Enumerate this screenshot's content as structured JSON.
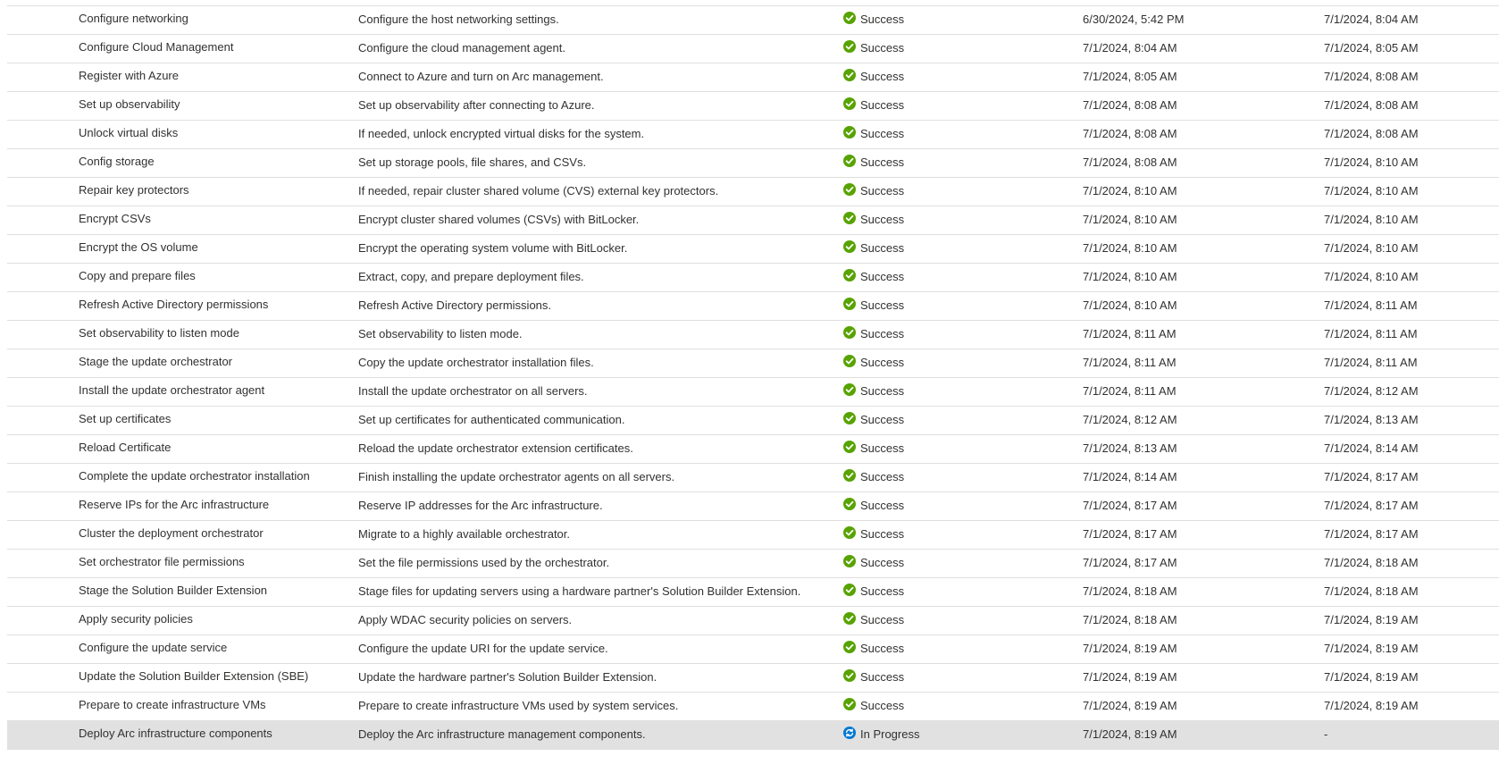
{
  "colors": {
    "success": "#57a300",
    "in_progress": "#0078d4",
    "row_border": "#e1dfdd",
    "selected_row": "#e1e1e1"
  },
  "rows": [
    {
      "name": "Configure networking",
      "description": "Configure the host networking settings.",
      "status": "Success",
      "status_icon": "success-check-icon",
      "start": "6/30/2024, 5:42 PM",
      "end": "7/1/2024, 8:04 AM"
    },
    {
      "name": "Configure Cloud Management",
      "description": "Configure the cloud management agent.",
      "status": "Success",
      "status_icon": "success-check-icon",
      "start": "7/1/2024, 8:04 AM",
      "end": "7/1/2024, 8:05 AM"
    },
    {
      "name": "Register with Azure",
      "description": "Connect to Azure and turn on Arc management.",
      "status": "Success",
      "status_icon": "success-check-icon",
      "start": "7/1/2024, 8:05 AM",
      "end": "7/1/2024, 8:08 AM"
    },
    {
      "name": "Set up observability",
      "description": "Set up observability after connecting to Azure.",
      "status": "Success",
      "status_icon": "success-check-icon",
      "start": "7/1/2024, 8:08 AM",
      "end": "7/1/2024, 8:08 AM"
    },
    {
      "name": "Unlock virtual disks",
      "description": "If needed, unlock encrypted virtual disks for the system.",
      "status": "Success",
      "status_icon": "success-check-icon",
      "start": "7/1/2024, 8:08 AM",
      "end": "7/1/2024, 8:08 AM"
    },
    {
      "name": "Config storage",
      "description": "Set up storage pools, file shares, and CSVs.",
      "status": "Success",
      "status_icon": "success-check-icon",
      "start": "7/1/2024, 8:08 AM",
      "end": "7/1/2024, 8:10 AM"
    },
    {
      "name": "Repair key protectors",
      "description": "If needed, repair cluster shared volume (CVS) external key protectors.",
      "status": "Success",
      "status_icon": "success-check-icon",
      "start": "7/1/2024, 8:10 AM",
      "end": "7/1/2024, 8:10 AM"
    },
    {
      "name": "Encrypt CSVs",
      "description": "Encrypt cluster shared volumes (CSVs) with BitLocker.",
      "status": "Success",
      "status_icon": "success-check-icon",
      "start": "7/1/2024, 8:10 AM",
      "end": "7/1/2024, 8:10 AM"
    },
    {
      "name": "Encrypt the OS volume",
      "description": "Encrypt the operating system volume with BitLocker.",
      "status": "Success",
      "status_icon": "success-check-icon",
      "start": "7/1/2024, 8:10 AM",
      "end": "7/1/2024, 8:10 AM"
    },
    {
      "name": "Copy and prepare files",
      "description": "Extract, copy, and prepare deployment files.",
      "status": "Success",
      "status_icon": "success-check-icon",
      "start": "7/1/2024, 8:10 AM",
      "end": "7/1/2024, 8:10 AM"
    },
    {
      "name": "Refresh Active Directory permissions",
      "description": "Refresh Active Directory permissions.",
      "status": "Success",
      "status_icon": "success-check-icon",
      "start": "7/1/2024, 8:10 AM",
      "end": "7/1/2024, 8:11 AM"
    },
    {
      "name": "Set observability to listen mode",
      "description": "Set observability to listen mode.",
      "status": "Success",
      "status_icon": "success-check-icon",
      "start": "7/1/2024, 8:11 AM",
      "end": "7/1/2024, 8:11 AM"
    },
    {
      "name": "Stage the update orchestrator",
      "description": "Copy the update orchestrator installation files.",
      "status": "Success",
      "status_icon": "success-check-icon",
      "start": "7/1/2024, 8:11 AM",
      "end": "7/1/2024, 8:11 AM"
    },
    {
      "name": "Install the update orchestrator agent",
      "description": "Install the update orchestrator on all servers.",
      "status": "Success",
      "status_icon": "success-check-icon",
      "start": "7/1/2024, 8:11 AM",
      "end": "7/1/2024, 8:12 AM"
    },
    {
      "name": "Set up certificates",
      "description": "Set up certificates for authenticated communication.",
      "status": "Success",
      "status_icon": "success-check-icon",
      "start": "7/1/2024, 8:12 AM",
      "end": "7/1/2024, 8:13 AM"
    },
    {
      "name": "Reload Certificate",
      "description": "Reload the update orchestrator extension certificates.",
      "status": "Success",
      "status_icon": "success-check-icon",
      "start": "7/1/2024, 8:13 AM",
      "end": "7/1/2024, 8:14 AM"
    },
    {
      "name": "Complete the update orchestrator installation",
      "description": "Finish installing the update orchestrator agents on all servers.",
      "status": "Success",
      "status_icon": "success-check-icon",
      "start": "7/1/2024, 8:14 AM",
      "end": "7/1/2024, 8:17 AM"
    },
    {
      "name": "Reserve IPs for the Arc infrastructure",
      "description": "Reserve IP addresses for the Arc infrastructure.",
      "status": "Success",
      "status_icon": "success-check-icon",
      "start": "7/1/2024, 8:17 AM",
      "end": "7/1/2024, 8:17 AM"
    },
    {
      "name": "Cluster the deployment orchestrator",
      "description": "Migrate to a highly available orchestrator.",
      "status": "Success",
      "status_icon": "success-check-icon",
      "start": "7/1/2024, 8:17 AM",
      "end": "7/1/2024, 8:17 AM"
    },
    {
      "name": "Set orchestrator file permissions",
      "description": "Set the file permissions used by the orchestrator.",
      "status": "Success",
      "status_icon": "success-check-icon",
      "start": "7/1/2024, 8:17 AM",
      "end": "7/1/2024, 8:18 AM"
    },
    {
      "name": "Stage the Solution Builder Extension",
      "description": "Stage files for updating servers using a hardware partner's Solution Builder Extension.",
      "status": "Success",
      "status_icon": "success-check-icon",
      "start": "7/1/2024, 8:18 AM",
      "end": "7/1/2024, 8:18 AM"
    },
    {
      "name": "Apply security policies",
      "description": "Apply WDAC security policies on servers.",
      "status": "Success",
      "status_icon": "success-check-icon",
      "start": "7/1/2024, 8:18 AM",
      "end": "7/1/2024, 8:19 AM"
    },
    {
      "name": "Configure the update service",
      "description": "Configure the update URI for the update service.",
      "status": "Success",
      "status_icon": "success-check-icon",
      "start": "7/1/2024, 8:19 AM",
      "end": "7/1/2024, 8:19 AM"
    },
    {
      "name": "Update the Solution Builder Extension (SBE)",
      "description": "Update the hardware partner's Solution Builder Extension.",
      "status": "Success",
      "status_icon": "success-check-icon",
      "start": "7/1/2024, 8:19 AM",
      "end": "7/1/2024, 8:19 AM"
    },
    {
      "name": "Prepare to create infrastructure VMs",
      "description": "Prepare to create infrastructure VMs used by system services.",
      "status": "Success",
      "status_icon": "success-check-icon",
      "start": "7/1/2024, 8:19 AM",
      "end": "7/1/2024, 8:19 AM"
    },
    {
      "name": "Deploy Arc infrastructure components",
      "description": "Deploy the Arc infrastructure management components.",
      "status": "In Progress",
      "status_icon": "in-progress-sync-icon",
      "start": "7/1/2024, 8:19 AM",
      "end": "-",
      "selected": true
    }
  ]
}
